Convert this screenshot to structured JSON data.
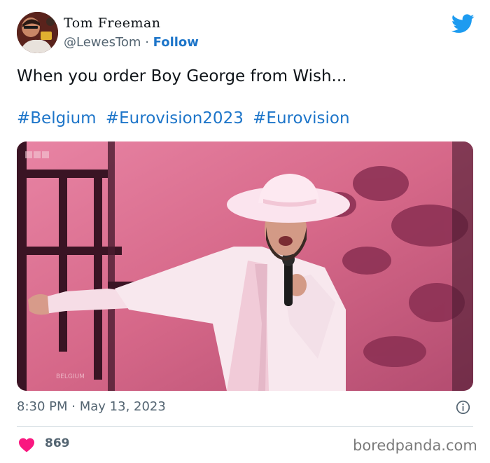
{
  "tweet": {
    "author_name": "Tom Freeman",
    "handle": "@LewesTom",
    "separator": "·",
    "follow_label": "Follow",
    "text": "When you order Boy George from Wish...",
    "hashtags": [
      "#Belgium",
      "#Eurovision2023",
      "#Eurovision"
    ],
    "media_overlay": {
      "logo": "BBC",
      "caption": "BELGIUM"
    },
    "time": "8:30 PM",
    "date": "May 13, 2023",
    "likes": "869"
  },
  "icons": {
    "brand": "twitter-bird-icon",
    "info": "info-icon",
    "like": "heart-icon"
  },
  "colors": {
    "link": "#1d75c9",
    "twitter_blue": "#1d9bf0",
    "heart": "#f91880",
    "muted": "#536471"
  },
  "watermark": "boredpanda.com"
}
